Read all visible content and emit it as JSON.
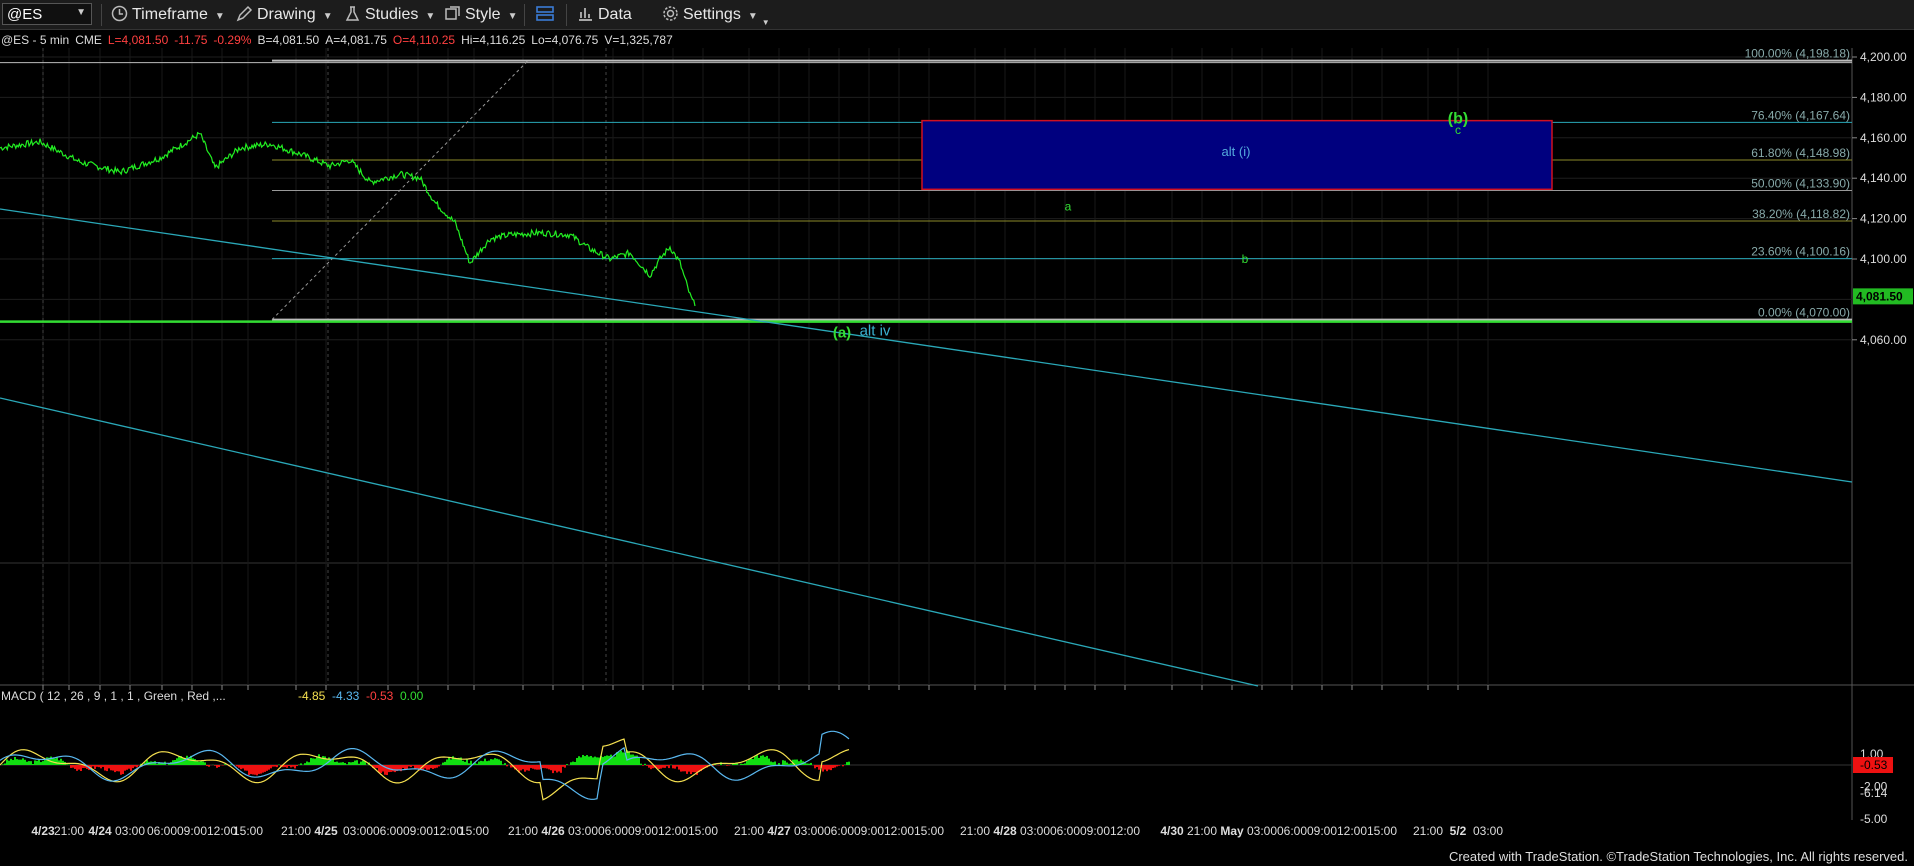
{
  "toolbar": {
    "symbol": "@ES",
    "timeframe": "Timeframe",
    "drawing": "Drawing",
    "studies": "Studies",
    "style": "Style",
    "data": "Data",
    "settings": "Settings"
  },
  "quote": {
    "symbol": "@ES - 5 min",
    "exchange": "CME",
    "last": "L=4,081.50",
    "change": "-11.75",
    "change_pct": "-0.29%",
    "bid": "B=4,081.50",
    "ask": "A=4,081.75",
    "open": "O=4,110.25",
    "high": "Hi=4,116.25",
    "low": "Lo=4,076.75",
    "volume": "V=1,325,787"
  },
  "colors": {
    "price_line": "#22ee22",
    "trend_line": "#2aa8b8",
    "target_box_fill": "#00007f",
    "target_box_border": "#d01020",
    "support_line": "#33dd33",
    "macd_hist_pos": "#11dd11",
    "macd_hist_neg": "#ee1111"
  },
  "chart_data": {
    "type": "line",
    "title": "@ES - 5 min",
    "y_ticks": [
      "4,200.00",
      "4,180.00",
      "4,160.00",
      "4,140.00",
      "4,120.00",
      "4,100.00",
      "4,060.00"
    ],
    "ylim": [
      4050,
      4205
    ],
    "x_ticks": [
      "4/23",
      "21:00",
      "4/24",
      "03:00",
      "06:00",
      "09:00",
      "12:00",
      "15:00",
      "21:00",
      "4/25",
      "03:00",
      "06:00",
      "09:00",
      "12:00",
      "15:00",
      "21:00",
      "4/26",
      "03:00",
      "06:00",
      "09:00",
      "12:00",
      "15:00",
      "21:00",
      "4/27",
      "03:00",
      "06:00",
      "09:00",
      "12:00",
      "15:00",
      "21:00",
      "4/28",
      "03:00",
      "06:00",
      "09:00",
      "12:00",
      "4/30",
      "21:00",
      "May",
      "03:00",
      "06:00",
      "09:00",
      "12:00",
      "15:00",
      "21:00",
      "5/2",
      "03:00"
    ],
    "last_price_label": "4,081.50",
    "price_series": {
      "name": "@ES",
      "x": [
        0,
        40,
        80,
        120,
        160,
        200,
        215,
        240,
        270,
        300,
        330,
        350,
        370,
        400,
        420,
        435,
        455,
        470,
        490,
        510,
        540,
        570,
        590,
        610,
        630,
        650,
        660,
        670,
        680,
        690,
        695
      ],
      "y": [
        4155,
        4158,
        4148,
        4143,
        4150,
        4162,
        4145,
        4155,
        4157,
        4152,
        4146,
        4149,
        4138,
        4142,
        4140,
        4128,
        4118,
        4098,
        4110,
        4112,
        4113,
        4112,
        4105,
        4100,
        4103,
        4092,
        4100,
        4106,
        4098,
        4082,
        4076.75
      ]
    },
    "fib_levels": [
      {
        "label": "100.00% (4,198.18)",
        "value": 4198.18
      },
      {
        "label": "76.40% (4,167.64)",
        "value": 4167.64
      },
      {
        "label": "61.80% (4,148.98)",
        "value": 4148.98
      },
      {
        "label": "50.00% (4,133.90)",
        "value": 4133.9
      },
      {
        "label": "38.20% (4,118.82)",
        "value": 4118.82
      },
      {
        "label": "23.60% (4,100.16)",
        "value": 4100.16
      },
      {
        "label": "0.00% (4,070.00)",
        "value": 4070.0
      }
    ],
    "target_box": {
      "y_top": 4168.5,
      "y_bottom": 4134.5
    },
    "wave_labels": [
      {
        "text": "alt (i)",
        "value": 4151
      },
      {
        "text": "(b)",
        "value": 4165
      },
      {
        "text": "c",
        "value": 4158
      },
      {
        "text": "a",
        "value": 4125
      },
      {
        "text": "b",
        "value": 4098
      },
      {
        "text": "(a)",
        "value": 4069
      },
      {
        "text": "alt iv",
        "value": 4069
      }
    ],
    "macd": {
      "label": "MACD ( 12 , 26 , 9 , 1 , 1 , Green , Red ,...",
      "values": [
        "-4.85",
        "-4.33",
        "-0.53",
        "0.00"
      ],
      "y_ticks": [
        "1.00",
        "-2.00",
        "-5.00"
      ],
      "value_labels": [
        "-0.53",
        "-6.14"
      ],
      "ylim": [
        -6.5,
        2.5
      ]
    },
    "grid": true
  },
  "footer": {
    "credit": "Created with TradeStation. ©TradeStation Technologies, Inc. All rights reserved."
  }
}
